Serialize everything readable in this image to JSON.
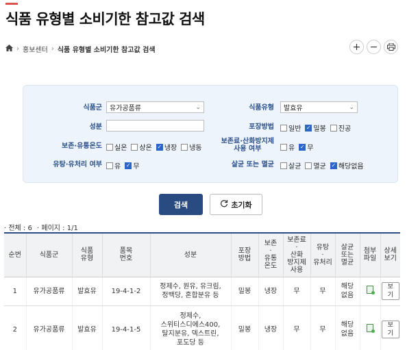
{
  "page": {
    "title": "식품 유형별 소비기한 참고값 검색"
  },
  "breadcrumb": {
    "home": "home-icon",
    "section": "홍보센터",
    "current": "식품 유형별 소비기한 참고값 검색"
  },
  "toolbar": {
    "zoom_in": "+",
    "zoom_out": "−",
    "print": "print-icon"
  },
  "form": {
    "food_group": {
      "label": "식품군",
      "value": "유가공품류"
    },
    "food_type": {
      "label": "식품유형",
      "value": "발효유"
    },
    "ingredient": {
      "label": "성분",
      "value": ""
    },
    "packaging": {
      "label": "포장방법",
      "options": [
        {
          "label": "일반",
          "checked": false
        },
        {
          "label": "밀봉",
          "checked": true
        },
        {
          "label": "진공",
          "checked": false
        }
      ]
    },
    "storage_temp": {
      "label": "보존·유통온도",
      "options": [
        {
          "label": "실온",
          "checked": false
        },
        {
          "label": "상온",
          "checked": false
        },
        {
          "label": "냉장",
          "checked": true
        },
        {
          "label": "냉동",
          "checked": false
        }
      ]
    },
    "preservative": {
      "label_line1": "보존료·산화방지제",
      "label_line2": "사용 여부",
      "options": [
        {
          "label": "유",
          "checked": false
        },
        {
          "label": "무",
          "checked": true
        }
      ]
    },
    "milk_process": {
      "label": "유탕·유처리 여부",
      "options": [
        {
          "label": "유",
          "checked": false
        },
        {
          "label": "무",
          "checked": true
        }
      ]
    },
    "sterilization": {
      "label": "살균 또는 멸균",
      "options": [
        {
          "label": "살균",
          "checked": false
        },
        {
          "label": "멸균",
          "checked": false
        },
        {
          "label": "해당없음",
          "checked": true
        }
      ]
    }
  },
  "buttons": {
    "search": "검색",
    "reset": "초기화"
  },
  "summary": {
    "total_label": "· 전체 : 6",
    "page_label": "· 페이지 : 1/1"
  },
  "table": {
    "headers": [
      [
        "순번"
      ],
      [
        "식품군"
      ],
      [
        "식품",
        "유형"
      ],
      [
        "품목",
        "번호"
      ],
      [
        "성분"
      ],
      [
        "포장",
        "방법"
      ],
      [
        "보존",
        "·",
        "유통",
        "온도"
      ],
      [
        "보존료",
        "·",
        "산화",
        "방지제",
        "사용"
      ],
      [
        "유탕",
        "·",
        "유처리"
      ],
      [
        "살균",
        "또는",
        "멸균"
      ],
      [
        "첨부",
        "파일"
      ],
      [
        "상세",
        "보기"
      ]
    ],
    "rows": [
      {
        "no": "1",
        "group": "유가공품류",
        "type": "발효유",
        "item_no": "19-4-1-2",
        "ingredient": [
          "정제수, 원유, 유크림,",
          "정백당, 혼합분유 등"
        ],
        "packaging": "밀봉",
        "storage": "냉장",
        "preservative": "무",
        "milk": "무",
        "steril": [
          "해당",
          "없음"
        ],
        "file": "file-icon",
        "view": "보기"
      },
      {
        "no": "2",
        "group": "유가공품류",
        "type": "발효유",
        "item_no": "19-4-1-5",
        "ingredient": [
          "정제수,",
          "스위티스디에스400,",
          "탈지분유, 덱스트린,",
          "포도당 등"
        ],
        "packaging": "밀봉",
        "storage": "냉장",
        "preservative": "무",
        "milk": "무",
        "steril": [
          "해당",
          "없음"
        ],
        "file": "file-icon",
        "view": "보기"
      }
    ]
  }
}
